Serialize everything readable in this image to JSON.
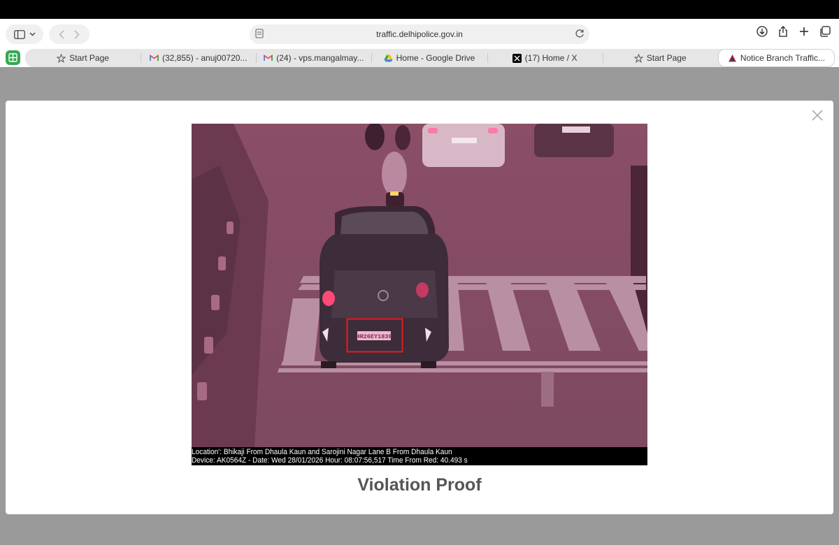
{
  "browser": {
    "address": "traffic.delhipolice.gov.in",
    "tabs": [
      {
        "label": "Start Page",
        "icon": "star-icon",
        "active": false
      },
      {
        "label": "(32,855) - anuj00720...",
        "icon": "gmail-icon",
        "active": false
      },
      {
        "label": "(24) - vps.mangalmay...",
        "icon": "gmail-icon",
        "active": false
      },
      {
        "label": "Home - Google Drive",
        "icon": "google-drive-icon",
        "active": false
      },
      {
        "label": "(17) Home / X",
        "icon": "x-logo-icon",
        "active": false
      },
      {
        "label": "Start Page",
        "icon": "star-icon",
        "active": false
      },
      {
        "label": "Notice Branch Traffic...",
        "icon": "delhi-police-icon",
        "active": true
      }
    ]
  },
  "modal": {
    "title": "Violation Proof",
    "image": {
      "plate_text": "HR26EY1839",
      "caption_line1": "Location': Bhikaji From Dhaula Kaun and Sarojini Nagar Lane B From Dhaula Kaun",
      "caption_line2": "Device: AK0564Z - Date: Wed 28/01/2026  Hour: 08:07:56,517 Time From Red: 40.493 s"
    }
  },
  "colors": {
    "backdrop": "#9a9a9a",
    "scene_tint": "#8a4a63",
    "highlight_box": "#e02020"
  }
}
